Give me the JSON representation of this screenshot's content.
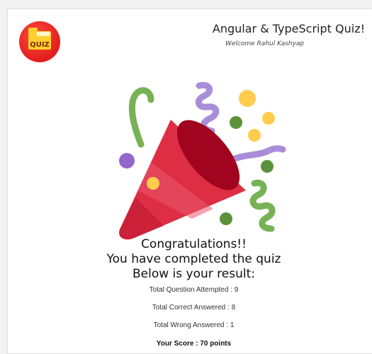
{
  "header": {
    "logo_text": "QUIZ",
    "title": "Angular & TypeScript Quiz!",
    "welcome": "Welcome Rahul Kashyap"
  },
  "result": {
    "congrats": "Congratulations!!",
    "completed": "You have completed the quiz",
    "below": "Below is your result:",
    "attempted": "Total Question Attempted : 9",
    "correct": "Total Correct Answered : 8",
    "wrong": "Total Wrong Answered : 1",
    "score": "Your Score : 70 points"
  },
  "illustration": {
    "icon": "party-popper-icon",
    "colors": {
      "cone": "#dd2e44",
      "cone_dark": "#a0041e",
      "streamer_green": "#77b255",
      "streamer_purple": "#aa8dd8",
      "confetti_yellow": "#ffcc4d",
      "confetti_green": "#5c913b"
    }
  }
}
